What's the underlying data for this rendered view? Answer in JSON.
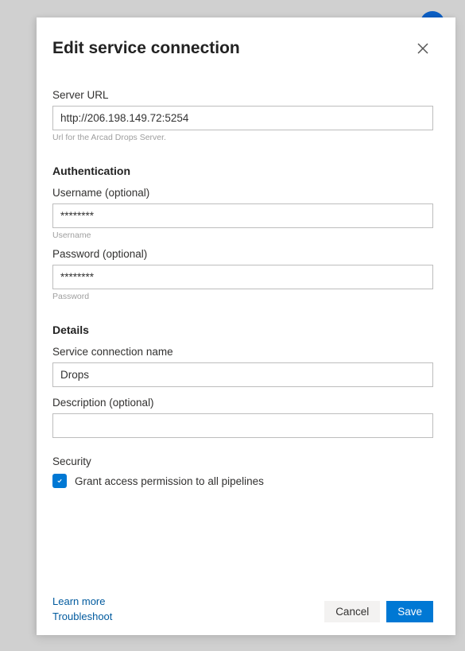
{
  "dialog": {
    "title": "Edit service connection"
  },
  "server": {
    "label": "Server URL",
    "value": "http://206.198.149.72:5254",
    "hint": "Url for the Arcad Drops Server."
  },
  "auth": {
    "section": "Authentication",
    "username_label": "Username (optional)",
    "username_value": "********",
    "username_hint": "Username",
    "password_label": "Password (optional)",
    "password_value": "********",
    "password_hint": "Password"
  },
  "details": {
    "section": "Details",
    "name_label": "Service connection name",
    "name_value": "Drops",
    "description_label": "Description (optional)",
    "description_value": ""
  },
  "security": {
    "label": "Security",
    "grant_text": "Grant access permission to all pipelines",
    "checked": true
  },
  "footer": {
    "learn_more": "Learn more",
    "troubleshoot": "Troubleshoot",
    "cancel": "Cancel",
    "save": "Save"
  }
}
